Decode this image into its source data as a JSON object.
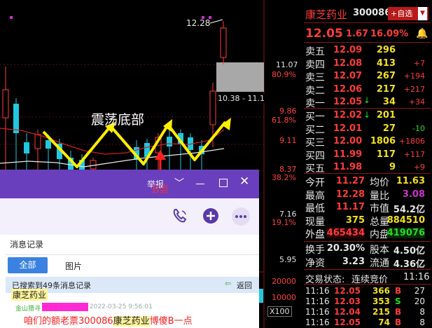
{
  "chart": {
    "price_labels": [
      "11.07",
      "9.86",
      "9.11",
      "8.37",
      "7.16",
      "5.95"
    ],
    "pct_labels": [
      "80.9%",
      "61.8%",
      "38.2%",
      "19.1%"
    ],
    "vol_labels": [
      "20000",
      "10000"
    ],
    "zoom_label": "X100",
    "high_marker": "12.28",
    "range_label": "10.38 - 11.1",
    "annotation_title": "震荡底部",
    "annotation_point": "B点",
    "report_label": "举报"
  },
  "stock": {
    "name": "康芝药业",
    "code": "300086",
    "add_button": "+自选",
    "price": "12.05",
    "change": "1.67",
    "change_pct": "16.09%"
  },
  "order_book": {
    "asks": [
      {
        "label": "卖五",
        "price": "12.09",
        "vol": "296",
        "chg": ""
      },
      {
        "label": "卖四",
        "price": "12.08",
        "vol": "413",
        "chg": "+7"
      },
      {
        "label": "卖三",
        "price": "12.07",
        "vol": "267",
        "chg": "+194"
      },
      {
        "label": "卖二",
        "price": "12.06",
        "vol": "217",
        "chg": "+217"
      },
      {
        "label": "卖一",
        "price": "12.05",
        "vol": "34",
        "chg": "+34"
      }
    ],
    "bids": [
      {
        "label": "买一",
        "price": "12.02",
        "vol": "201",
        "chg": ""
      },
      {
        "label": "买二",
        "price": "12.01",
        "vol": "27",
        "chg": "-10"
      },
      {
        "label": "买三",
        "price": "12.00",
        "vol": "1806",
        "chg": "+1806"
      },
      {
        "label": "买四",
        "price": "11.99",
        "vol": "117",
        "chg": "+117"
      },
      {
        "label": "买五",
        "price": "11.98",
        "vol": "9",
        "chg": "+9"
      }
    ]
  },
  "stats": {
    "open_label": "今开",
    "open": "11.27",
    "avg_label": "均价",
    "avg": "11.63",
    "high_label": "最高",
    "high": "12.28",
    "ratio_label": "量比",
    "ratio": "3.08",
    "low_label": "最低",
    "low": "11.17",
    "mktcap_label": "市值",
    "mktcap": "54.2亿",
    "now_label": "现量",
    "now": "375",
    "total_label": "总量",
    "total": "884510",
    "outer_label": "外盘",
    "outer": "465434",
    "inner_label": "内盘",
    "inner": "419076",
    "turnover_label": "换手",
    "turnover": "20.30%",
    "shares_label": "股本",
    "shares": "4.50亿",
    "nav_label": "净资",
    "nav": "3.23",
    "float_label": "流通",
    "float": "4.36亿"
  },
  "trade_status": {
    "label": "交易状态:",
    "value": "连续竞价",
    "time": "11:16"
  },
  "ticks": [
    {
      "time": "11:16",
      "price": "12.05",
      "vol": "366",
      "side": "B",
      "n": "27"
    },
    {
      "time": "11:16",
      "price": "12.03",
      "vol": "353",
      "side": "S",
      "n": "20"
    },
    {
      "time": "11:16",
      "price": "12.04",
      "vol": "215",
      "side": "B",
      "n": "8"
    },
    {
      "time": "11:16",
      "price": "12.05",
      "vol": "74",
      "side": "B",
      "n": "8"
    }
  ],
  "chat": {
    "records_label": "消息记录",
    "tab_all": "全部",
    "tab_image": "图片",
    "found_text": "已搜索到49条消息记录",
    "back_label": "返回",
    "prev_message": "康芝药业",
    "sender": "金山猎寻",
    "timestamp": "2022-03-25 9:56:01",
    "message_prefix": "咱们的额老票300086",
    "message_highlight": "康芝药业",
    "message_suffix": "博傻B一点"
  }
}
